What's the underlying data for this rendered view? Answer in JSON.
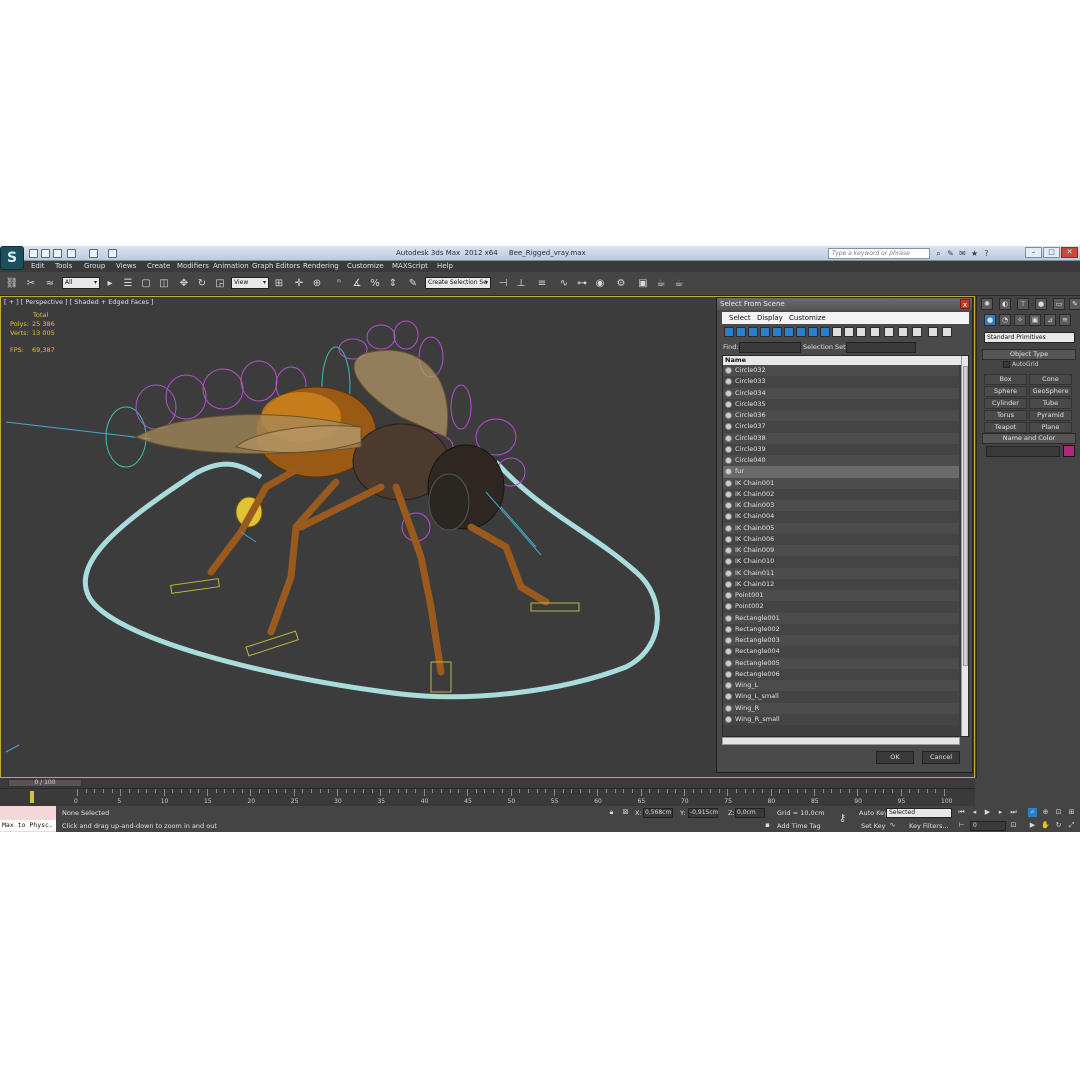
{
  "app": {
    "logo": "S",
    "title": "Autodesk 3ds Max  2012 x64     Bee_Rigged_vray.max",
    "search_placeholder": "Type a keyword or phrase"
  },
  "menu": {
    "items": [
      "Edit",
      "Tools",
      "Group",
      "Views",
      "Create",
      "Modifiers",
      "Animation",
      "Graph Editors",
      "Rendering",
      "Customize",
      "MAXScript",
      "Help"
    ]
  },
  "toolbar": {
    "filter_value": "All",
    "coord_system": "View",
    "named_selection": "Create Selection Se"
  },
  "viewport": {
    "label": "[ + ] [ Perspective ] [ Shaded + Edged Faces ]",
    "stats": {
      "total_label": "Total",
      "polys_label": "Polys:",
      "polys_value": "25 386",
      "verts_label": "Verts:",
      "verts_value": "13 005",
      "fps_label": "FPS:",
      "fps_value": "69,387"
    }
  },
  "dialog": {
    "title": "Select From Scene",
    "close": "x",
    "menus": [
      "Select",
      "Display",
      "Customize"
    ],
    "find_label": "Find:",
    "selection_set_label": "Selection Set:",
    "column_name": "Name",
    "items": [
      "Circle032",
      "Circle033",
      "Circle034",
      "Circle035",
      "Circle036",
      "Circle037",
      "Circle038",
      "Circle039",
      "Circle040",
      "fur",
      "IK Chain001",
      "IK Chain002",
      "IK Chain003",
      "IK Chain004",
      "IK Chain005",
      "IK Chain006",
      "IK Chain009",
      "IK Chain010",
      "IK Chain011",
      "IK Chain012",
      "Point001",
      "Point002",
      "Rectangle001",
      "Rectangle002",
      "Rectangle003",
      "Rectangle004",
      "Rectangle005",
      "Rectangle006",
      "Wing_L",
      "Wing_L_small",
      "Wing_R",
      "Wing_R_small"
    ],
    "ok_label": "OK",
    "cancel_label": "Cancel"
  },
  "command_panel": {
    "category": "Standard Primitives",
    "object_type_title": "Object Type",
    "autogrid_label": "AutoGrid",
    "buttons": [
      "Box",
      "Cone",
      "Sphere",
      "GeoSphere",
      "Cylinder",
      "Tube",
      "Torus",
      "Pyramid",
      "Teapot",
      "Plane"
    ],
    "name_color_title": "Name and Color",
    "color": "#b3267e"
  },
  "timeline": {
    "frame_display": "0 / 100",
    "ticks": [
      "0",
      "5",
      "10",
      "15",
      "20",
      "25",
      "30",
      "35",
      "40",
      "45",
      "50",
      "55",
      "60",
      "65",
      "70",
      "75",
      "80",
      "85",
      "90",
      "95",
      "100"
    ]
  },
  "status": {
    "maxscript_text": "Max to Physc.",
    "selection": "None Selected",
    "prompt": "Click and drag up-and-down to zoom in and out",
    "x_label": "X:",
    "x_value": "0,568cm",
    "y_label": "Y:",
    "y_value": "-0,915cm",
    "z_label": "Z:",
    "z_value": "0,0cm",
    "grid": "Grid = 10,0cm",
    "add_time_tag": "Add Time Tag",
    "auto_key": "Auto Key",
    "set_key": "Set Key",
    "key_mode": "Selected",
    "key_filters": "Key Filters...",
    "frame_value": "0"
  },
  "colors": {
    "viewport_bg": "#3c3c3c",
    "viewport_border": "#c7a83a",
    "stat_text": "#e7c13a",
    "ground_ring": "#a9dcdc",
    "rig_controls": "#b44fd0"
  }
}
